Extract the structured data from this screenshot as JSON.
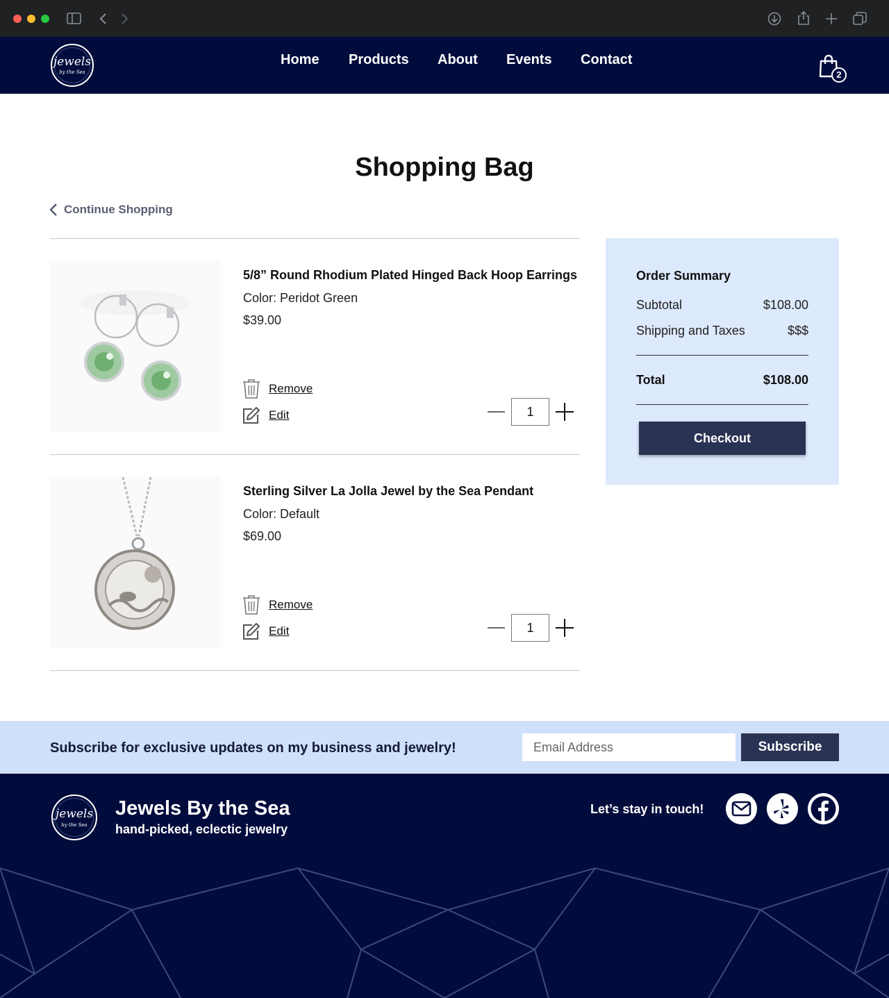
{
  "browser": {
    "traffic_lights": {
      "close": "#ff5f57",
      "minimize": "#febc2e",
      "zoom": "#28c840"
    }
  },
  "nav": {
    "logo_text": "jewels",
    "logo_subtext": "by the Sea",
    "links": [
      "Home",
      "Products",
      "About",
      "Events",
      "Contact"
    ],
    "cart_count": "2"
  },
  "page": {
    "title": "Shopping Bag",
    "continue_label": "Continue Shopping"
  },
  "cart": {
    "items": [
      {
        "title": "5/8” Round Rhodium Plated Hinged Back Hoop Earrings",
        "color": "Color: Peridot Green",
        "price": "$39.00",
        "remove_label": "Remove",
        "edit_label": "Edit",
        "quantity": "1"
      },
      {
        "title": "Sterling Silver La Jolla Jewel by the Sea Pendant",
        "color": "Color: Default",
        "price": "$69.00",
        "remove_label": "Remove",
        "edit_label": "Edit",
        "quantity": "1"
      }
    ]
  },
  "summary": {
    "title": "Order Summary",
    "subtotal_label": "Subtotal",
    "subtotal_value": "$108.00",
    "shipping_label": "Shipping and Taxes",
    "shipping_value": "$$$",
    "total_label": "Total",
    "total_value": "$108.00",
    "checkout_label": "Checkout"
  },
  "subscribe": {
    "text": "Subscribe for exclusive updates on my business and jewelry!",
    "email_placeholder": "Email Address",
    "button_label": "Subscribe"
  },
  "footer": {
    "brand_name": "Jewels By the Sea",
    "tagline": "hand-picked, eclectic jewelry",
    "touch_text": "Let’s stay in touch!",
    "social": [
      "mail-icon",
      "yelp-icon",
      "facebook-icon"
    ]
  },
  "colors": {
    "navy": "#020c3c",
    "button": "#2b3354",
    "summary_bg": "#dde9fc",
    "subscribe_bg": "#cfe0fb"
  }
}
